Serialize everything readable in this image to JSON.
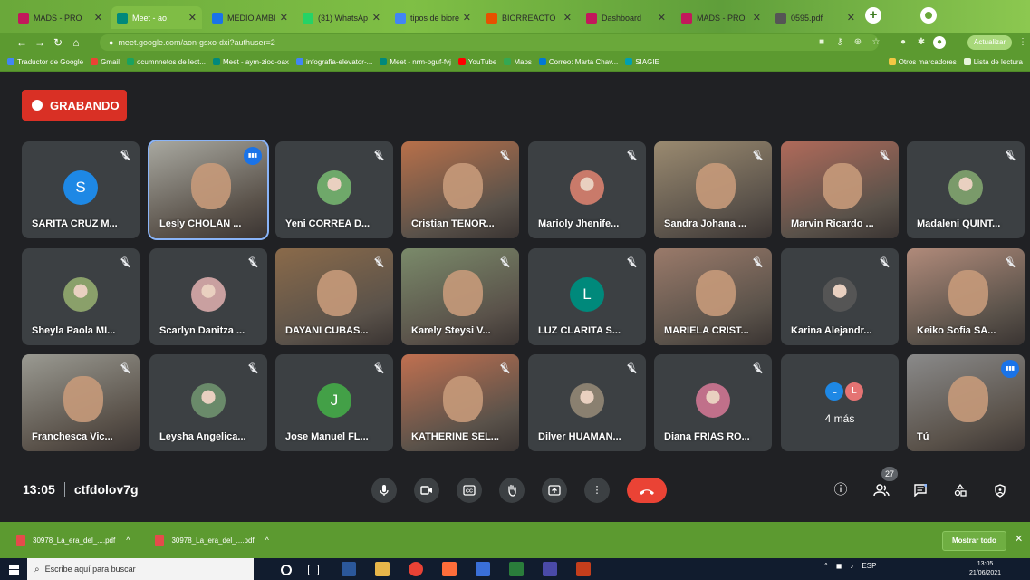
{
  "browser": {
    "tabs": [
      {
        "label": "MADS - PRO",
        "color": "#c2185b"
      },
      {
        "label": "Meet - ao",
        "color": "#00897b",
        "active": true
      },
      {
        "label": "MEDIO AMBI",
        "color": "#1a73e8"
      },
      {
        "label": "(31) WhatsAp",
        "color": "#25d366"
      },
      {
        "label": "tipos de biore",
        "color": "#4285f4"
      },
      {
        "label": "BIORREACTO",
        "color": "#e65100"
      },
      {
        "label": "Dashboard",
        "color": "#c2185b"
      },
      {
        "label": "MADS - PRO",
        "color": "#c2185b"
      },
      {
        "label": "0595.pdf",
        "color": "#555555"
      }
    ],
    "url": "meet.google.com/aon-gsxo-dxi?authuser=2",
    "update_label": "Actualizar",
    "bookmarks": [
      "Traductor de Google",
      "Gmail",
      "ocumnnetos de lect...",
      "Meet - aym-ziod-oax",
      "infografia-elevator-...",
      "Meet - nrm-pguf-fvj",
      "YouTube",
      "Maps",
      "Correo: Marta Chav...",
      "SIAGIE"
    ],
    "other_bookmarks": "Otros marcadores",
    "reading_list": "Lista de lectura"
  },
  "meet": {
    "recording_label": "GRABANDO",
    "participants": [
      {
        "name": "SARITA CRUZ M...",
        "kind": "initial",
        "initial": "S",
        "color": "#1e88e5"
      },
      {
        "name": "Lesly CHOLAN ...",
        "kind": "video",
        "color": "#a8a8a0",
        "speaking": true
      },
      {
        "name": "Yeni CORREA D...",
        "kind": "photo",
        "color": "#6fa86a"
      },
      {
        "name": "Cristian TENOR...",
        "kind": "video",
        "color": "#b8704a"
      },
      {
        "name": "Marioly Jhenife...",
        "kind": "photo",
        "color": "#c97a6a"
      },
      {
        "name": "Sandra Johana ...",
        "kind": "video",
        "color": "#9a8a70"
      },
      {
        "name": "Marvin Ricardo ...",
        "kind": "video",
        "color": "#b06a5a"
      },
      {
        "name": "Madaleni QUINT...",
        "kind": "photo",
        "color": "#7a9a6a"
      },
      {
        "name": "Sheyla Paola MI...",
        "kind": "photo",
        "color": "#8aa06a"
      },
      {
        "name": "Scarlyn Danitza ...",
        "kind": "photo",
        "color": "#c9a0a0"
      },
      {
        "name": "DAYANI CUBAS...",
        "kind": "video",
        "color": "#8a6a4a"
      },
      {
        "name": "Karely Steysi V...",
        "kind": "video",
        "color": "#7a8a6a"
      },
      {
        "name": "LUZ CLARITA S...",
        "kind": "initial",
        "initial": "L",
        "color": "#00897b"
      },
      {
        "name": "MARIELA CRIST...",
        "kind": "video",
        "color": "#9a7a6a"
      },
      {
        "name": "Karina Alejandr...",
        "kind": "photo",
        "color": "#555555"
      },
      {
        "name": "Keiko Sofia SA...",
        "kind": "video",
        "color": "#b08a7a"
      },
      {
        "name": "Franchesca Vic...",
        "kind": "video",
        "color": "#9a9a92"
      },
      {
        "name": "Leysha Angelica...",
        "kind": "photo",
        "color": "#6a8a6a"
      },
      {
        "name": "Jose Manuel FL...",
        "kind": "initial",
        "initial": "J",
        "color": "#43a047"
      },
      {
        "name": "KATHERINE SEL...",
        "kind": "video",
        "color": "#c07050"
      },
      {
        "name": "Dilver HUAMAN...",
        "kind": "photo",
        "color": "#8a8070"
      },
      {
        "name": "Diana FRIAS RO...",
        "kind": "photo",
        "color": "#c0708a"
      },
      {
        "name": "4 más",
        "kind": "more",
        "badges": [
          "L",
          "L"
        ],
        "badge_colors": [
          "#1e88e5",
          "#e57373"
        ]
      },
      {
        "name": "Tú",
        "kind": "video",
        "color": "#8a8a8a",
        "self": true
      }
    ],
    "time": "13:05",
    "meeting_code": "ctfdolov7g",
    "participant_count": "27"
  },
  "downloads": {
    "items": [
      "30978_La_era_del_....pdf",
      "30978_La_era_del_....pdf"
    ],
    "show_all": "Mostrar todo"
  },
  "taskbar": {
    "search_placeholder": "Escribe aquí para buscar",
    "language": "ESP",
    "clock_time": "13:05",
    "clock_date": "21/06/2021"
  }
}
